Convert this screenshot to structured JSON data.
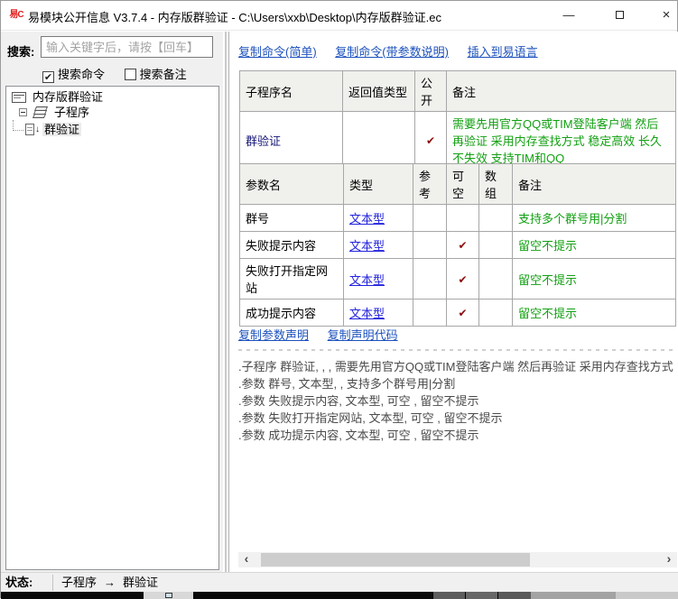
{
  "window": {
    "title": "易模块公开信息 V3.7.4 - 内存版群验证 - C:\\Users\\xxb\\Desktop\\内存版群验证.ec",
    "app_icon_glyph": "易C",
    "minimize_glyph": "—",
    "close_glyph": "×"
  },
  "search": {
    "label": "搜索:",
    "placeholder": "输入关键字后，请按【回车】",
    "check_glyph": "✔",
    "cmd_checkbox_label": "搜索命令",
    "note_checkbox_label": "搜索备注"
  },
  "tree": {
    "root": "内存版群验证",
    "group": "子程序",
    "leaf": "群验证"
  },
  "toolbar_links": [
    "复制命令(简单)",
    "复制命令(带参数说明)",
    "插入到易语言"
  ],
  "sub_table": {
    "headers": [
      "子程序名",
      "返回值类型",
      "公开",
      "备注"
    ],
    "row": {
      "name": "群验证",
      "ret": "",
      "public": "✔",
      "remark": "需要先用官方QQ或TIM登陆客户端 然后再验证 采用内存查找方式 稳定高效 长久不失效 支持TIM和QQ"
    }
  },
  "param_table": {
    "headers": [
      "参数名",
      "类型",
      "参考",
      "可空",
      "数组",
      "备注"
    ],
    "rows": [
      {
        "name": "群号",
        "type": "文本型",
        "ref": "",
        "nullable": "",
        "array": "",
        "remark": "支持多个群号用|分割"
      },
      {
        "name": "失败提示内容",
        "type": "文本型",
        "ref": "",
        "nullable": "✔",
        "array": "",
        "remark": "留空不提示"
      },
      {
        "name": "失败打开指定网站",
        "type": "文本型",
        "ref": "",
        "nullable": "✔",
        "array": "",
        "remark": "留空不提示"
      },
      {
        "name": "成功提示内容",
        "type": "文本型",
        "ref": "",
        "nullable": "✔",
        "array": "",
        "remark": "留空不提示"
      }
    ]
  },
  "declare_links": [
    "复制参数声明",
    "复制声明代码"
  ],
  "code_lines": [
    ".子程序 群验证, , , 需要先用官方QQ或TIM登陆客户端 然后再验证 采用内存查找方式",
    ".参数 群号, 文本型, , 支持多个群号用|分割",
    ".参数 失败提示内容, 文本型, 可空 , 留空不提示",
    ".参数 失败打开指定网站, 文本型, 可空 , 留空不提示",
    ".参数 成功提示内容, 文本型, 可空 , 留空不提示"
  ],
  "scrollbar": {
    "left_glyph": "‹",
    "right_glyph": "›"
  },
  "status": {
    "label": "状态:",
    "crumb1": "子程序",
    "arrow": "→",
    "crumb2": "群验证"
  },
  "colors": {
    "link_blue": "#1d52bd",
    "type_blue": "#2323dd",
    "remark_green": "#12a012",
    "check_red": "#8a0d0d",
    "name_navy": "#181878",
    "icon_red": "#e21b1b"
  }
}
